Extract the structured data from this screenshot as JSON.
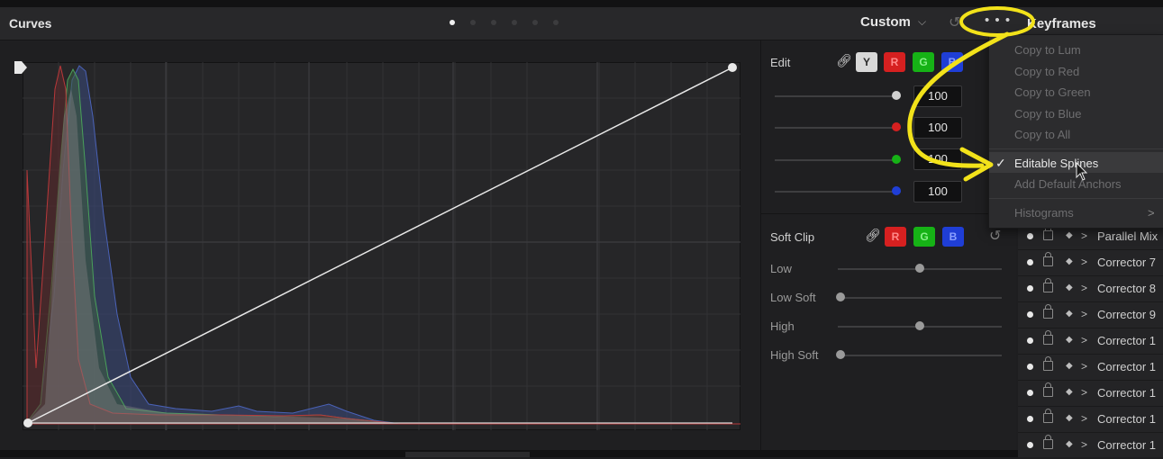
{
  "header": {
    "title": "Curves",
    "page_dots": 6,
    "active_dot": 0,
    "mode": "Custom",
    "mode_icon": "chevron-down-icon",
    "keyframes_title": "Keyframes"
  },
  "edit": {
    "label": "Edit",
    "channel_chips": [
      "Y",
      "R",
      "G",
      "B"
    ],
    "sliders": [
      {
        "channel": "luma",
        "color": "#d0d0d0",
        "value": "100"
      },
      {
        "channel": "red",
        "color": "#d62020",
        "value": "100"
      },
      {
        "channel": "green",
        "color": "#16b216",
        "value": "100"
      },
      {
        "channel": "blue",
        "color": "#1f3ed6",
        "value": "100"
      }
    ]
  },
  "soft_clip": {
    "label": "Soft Clip",
    "channel_chips": [
      "R",
      "G",
      "B"
    ],
    "rows": [
      {
        "label": "Low",
        "level": 0.5
      },
      {
        "label": "Low Soft",
        "level": 0.0
      },
      {
        "label": "High",
        "level": 0.5
      },
      {
        "label": "High Soft",
        "level": 0.0
      }
    ]
  },
  "menu": {
    "items": [
      {
        "label": "Copy to Lum",
        "enabled": false,
        "checked": false
      },
      {
        "label": "Copy to Red",
        "enabled": false,
        "checked": false
      },
      {
        "label": "Copy to Green",
        "enabled": false,
        "checked": false
      },
      {
        "label": "Copy to Blue",
        "enabled": false,
        "checked": false
      },
      {
        "label": "Copy to All",
        "enabled": false,
        "checked": false
      },
      {
        "label": "Editable Splines",
        "enabled": true,
        "checked": true
      },
      {
        "label": "Add Default Anchors",
        "enabled": false,
        "checked": false
      },
      {
        "label": "Histograms",
        "enabled": false,
        "checked": false,
        "submenu": true
      }
    ],
    "check_mark": "✓",
    "submenu_arrow": ">"
  },
  "keyframes": {
    "rows": [
      "Parallel Mix",
      "Corrector 7",
      "Corrector 8",
      "Corrector 9",
      "Corrector 1",
      "Corrector 1",
      "Corrector 1",
      "Corrector 1",
      "Corrector 1"
    ]
  },
  "colors": {
    "annotation": "#f2e21a",
    "curve": "#e8e8e8",
    "hist_red": "#b8383a",
    "hist_green": "#4aa05a",
    "hist_blue": "#4a62b8"
  }
}
